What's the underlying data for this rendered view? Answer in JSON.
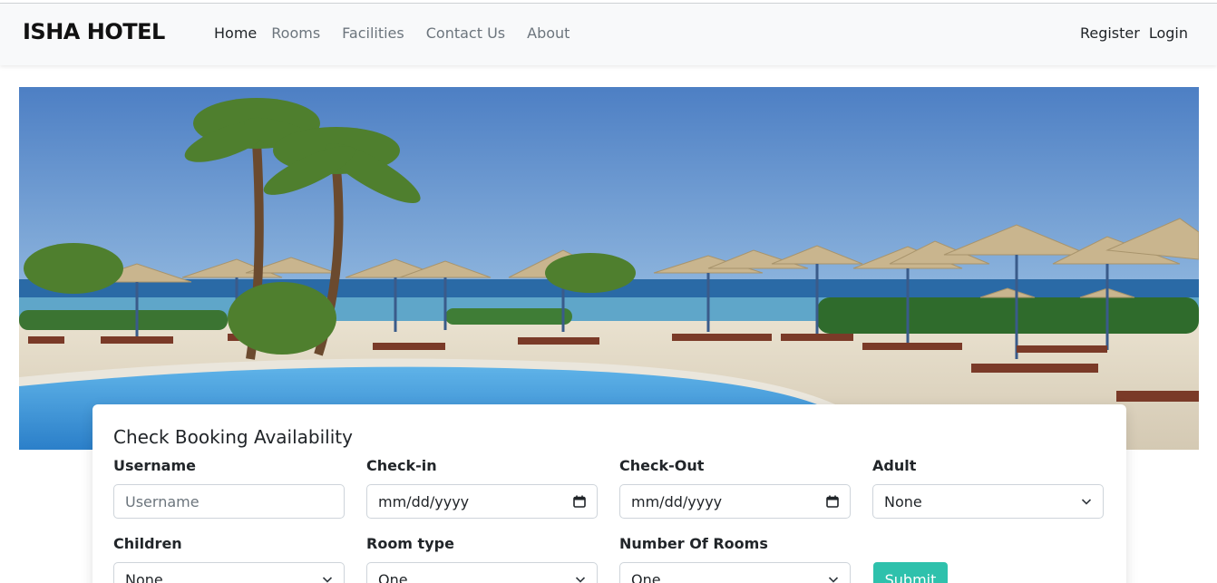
{
  "navbar": {
    "brand": "ISHA HOTEL",
    "links": [
      {
        "label": "Home",
        "active": true
      },
      {
        "label": "Rooms",
        "active": false
      },
      {
        "label": "Facilities",
        "active": false
      },
      {
        "label": "Contact Us",
        "active": false
      },
      {
        "label": "About",
        "active": false
      }
    ],
    "register_label": "Register",
    "login_label": "Login"
  },
  "hero": {
    "image_semantic": "resort-pool-beach-palm-trees-photo"
  },
  "booking": {
    "title": "Check Booking Availability",
    "username_label": "Username",
    "username_placeholder": "Username",
    "checkin_label": "Check-in",
    "checkin_value": "mm/dd/yyyy",
    "checkout_label": "Check-Out",
    "checkout_value": "mm/dd/yyyy",
    "adult_label": "Adult",
    "adult_value": "None",
    "children_label": "Children",
    "children_value": "None",
    "roomtype_label": "Room type",
    "roomtype_value": "One",
    "numrooms_label": "Number Of Rooms",
    "numrooms_value": "One",
    "submit_label": "Submit"
  },
  "colors": {
    "navbar_bg": "#f8f9fa",
    "accent": "#2ec1ac",
    "text": "#212529",
    "muted": "#6c757d"
  }
}
